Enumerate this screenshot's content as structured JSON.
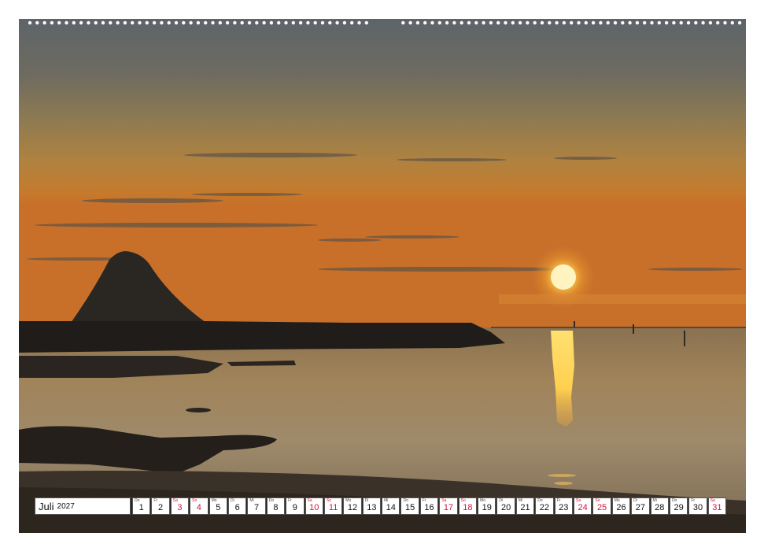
{
  "calendar": {
    "month": "Juli",
    "year": "2027",
    "weekend_color": "#d4143a",
    "days": [
      {
        "abbr": "Do",
        "num": "1",
        "weekend": false
      },
      {
        "abbr": "Fr",
        "num": "2",
        "weekend": false
      },
      {
        "abbr": "Sa",
        "num": "3",
        "weekend": true
      },
      {
        "abbr": "So",
        "num": "4",
        "weekend": true
      },
      {
        "abbr": "Mo",
        "num": "5",
        "weekend": false
      },
      {
        "abbr": "Di",
        "num": "6",
        "weekend": false
      },
      {
        "abbr": "Mi",
        "num": "7",
        "weekend": false
      },
      {
        "abbr": "Do",
        "num": "8",
        "weekend": false
      },
      {
        "abbr": "Fr",
        "num": "9",
        "weekend": false
      },
      {
        "abbr": "Sa",
        "num": "10",
        "weekend": true
      },
      {
        "abbr": "So",
        "num": "11",
        "weekend": true
      },
      {
        "abbr": "Mo",
        "num": "12",
        "weekend": false
      },
      {
        "abbr": "Di",
        "num": "13",
        "weekend": false
      },
      {
        "abbr": "Mi",
        "num": "14",
        "weekend": false
      },
      {
        "abbr": "Do",
        "num": "15",
        "weekend": false
      },
      {
        "abbr": "Fr",
        "num": "16",
        "weekend": false
      },
      {
        "abbr": "Sa",
        "num": "17",
        "weekend": true
      },
      {
        "abbr": "So",
        "num": "18",
        "weekend": true
      },
      {
        "abbr": "Mo",
        "num": "19",
        "weekend": false
      },
      {
        "abbr": "Di",
        "num": "20",
        "weekend": false
      },
      {
        "abbr": "Mi",
        "num": "21",
        "weekend": false
      },
      {
        "abbr": "Do",
        "num": "22",
        "weekend": false
      },
      {
        "abbr": "Fr",
        "num": "23",
        "weekend": false
      },
      {
        "abbr": "Sa",
        "num": "24",
        "weekend": true
      },
      {
        "abbr": "So",
        "num": "25",
        "weekend": true
      },
      {
        "abbr": "Mo",
        "num": "26",
        "weekend": false
      },
      {
        "abbr": "Di",
        "num": "27",
        "weekend": false
      },
      {
        "abbr": "Mi",
        "num": "28",
        "weekend": false
      },
      {
        "abbr": "Do",
        "num": "29",
        "weekend": false
      },
      {
        "abbr": "Fr",
        "num": "30",
        "weekend": false
      },
      {
        "abbr": "Sa",
        "num": "31",
        "weekend": true
      }
    ]
  }
}
